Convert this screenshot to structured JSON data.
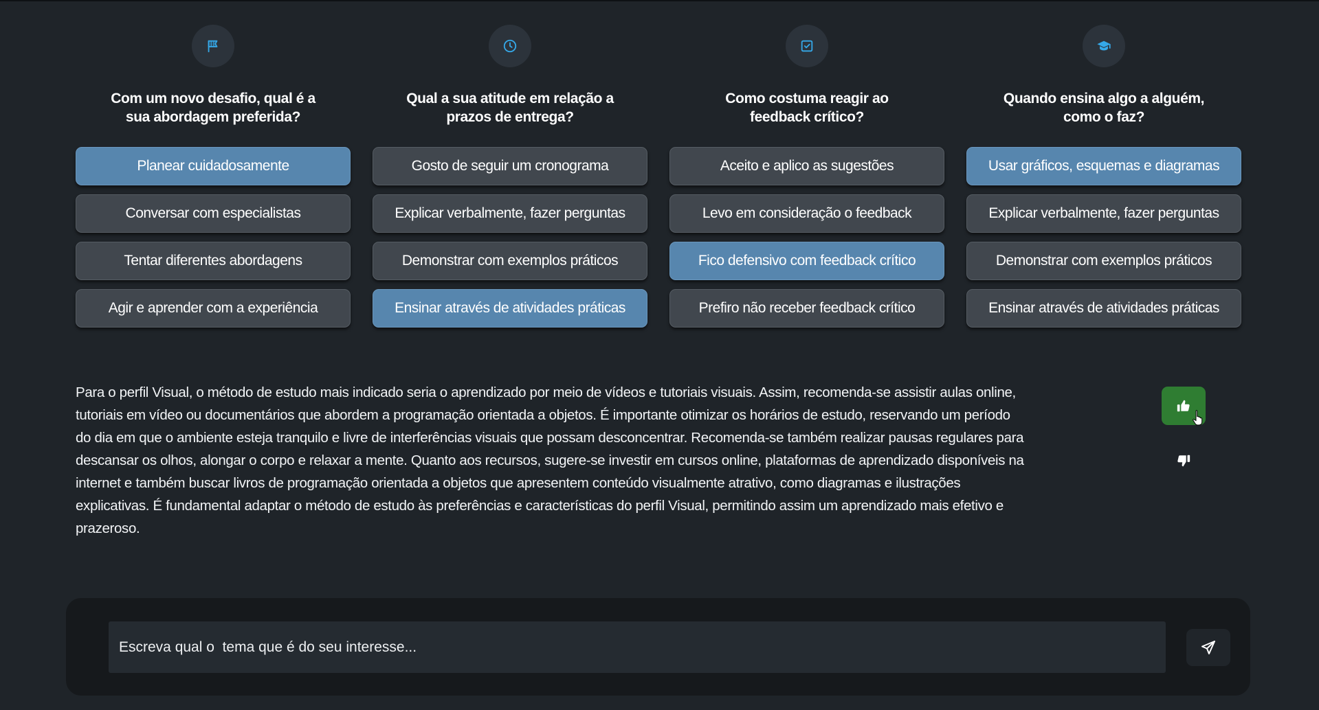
{
  "colors": {
    "background": "#1f2429",
    "option_default": "#41474e",
    "option_selected": "#5786ae",
    "icon_accent": "#35a8e8",
    "like_active": "#2f7d32",
    "composer_bg": "#16191c"
  },
  "questions": [
    {
      "icon": "flag-icon",
      "title": "Com um novo desafio, qual é a sua abordagem preferida?",
      "options": [
        "Planear cuidadosamente",
        "Conversar com especialistas",
        "Tentar diferentes abordagens",
        "Agir e aprender com a experiência"
      ],
      "selected_index": 0
    },
    {
      "icon": "clock-icon",
      "title": "Qual a sua atitude em relação a prazos de entrega?",
      "options": [
        "Gosto de seguir um cronograma",
        "Explicar verbalmente, fazer perguntas",
        "Demonstrar com exemplos práticos",
        "Ensinar através de atividades práticas"
      ],
      "selected_index": 3
    },
    {
      "icon": "checkbox-icon",
      "title": "Como costuma reagir ao feedback crítico?",
      "options": [
        "Aceito e aplico as sugestões",
        "Levo em consideração o feedback",
        "Fico defensivo com feedback crítico",
        "Prefiro não receber feedback crítico"
      ],
      "selected_index": 2
    },
    {
      "icon": "graduation-cap-icon",
      "title": "Quando ensina algo a alguém, como o faz?",
      "options": [
        "Usar gráficos, esquemas e diagramas",
        "Explicar verbalmente, fazer perguntas",
        "Demonstrar com exemplos práticos",
        "Ensinar através de atividades práticas"
      ],
      "selected_index": 0
    }
  ],
  "answer": {
    "lines": [
      "Para o perfil Visual, o método de estudo mais indicado seria o aprendizado por meio de vídeos e tutoriais visuais. Assim, recomenda-se assistir aulas online,",
      "tutoriais em vídeo ou documentários que abordem a programação orientada a objetos. É importante otimizar os horários de estudo, reservando um período",
      "do dia em que o ambiente esteja tranquilo e livre de interferências visuais que possam desconcentrar. Recomenda-se também realizar pausas regulares para",
      "descansar os olhos, alongar o corpo e relaxar a mente. Quanto aos recursos, sugere-se investir em cursos online, plataformas de aprendizado disponíveis na",
      "internet e também buscar livros de programação orientada a objetos que apresentem conteúdo visualmente atrativo, como diagramas e ilustrações",
      "explicativas. É fundamental adaptar o método de estudo às preferências e características do perfil Visual, permitindo assim um aprendizado mais efetivo e",
      "prazeroso."
    ],
    "like_icon": "thumbs-up-icon",
    "dislike_icon": "thumbs-down-icon"
  },
  "composer": {
    "placeholder": "Escreva qual o  tema que é do seu interesse...",
    "send_icon": "send-icon"
  }
}
